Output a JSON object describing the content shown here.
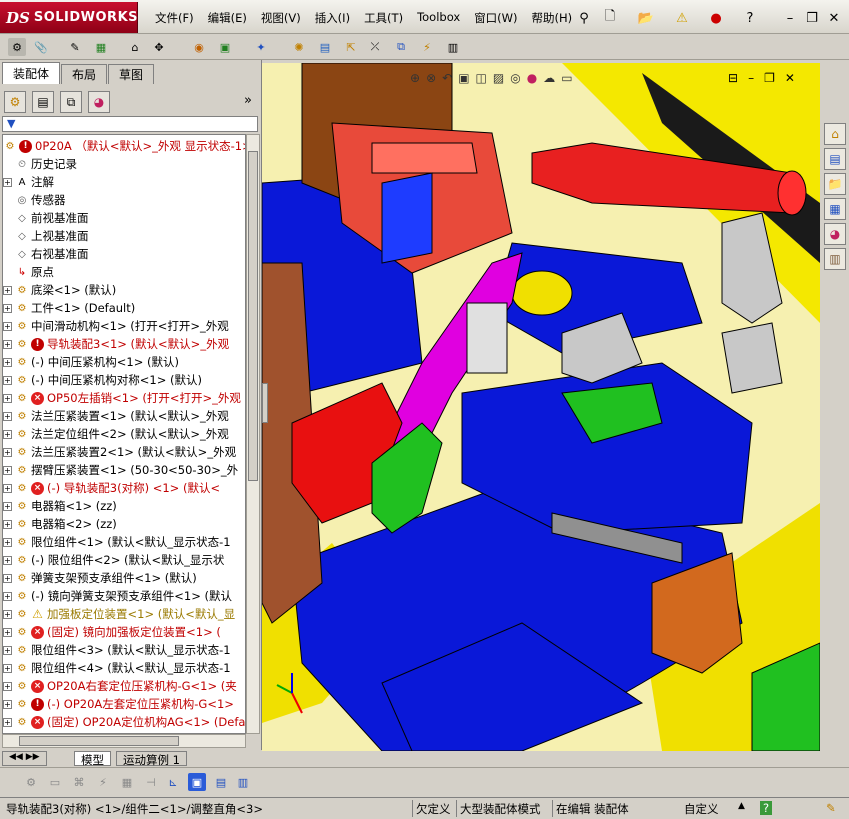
{
  "app": {
    "logo_ds": "DS",
    "logo_name": "SOLIDWORKS"
  },
  "menu": [
    "文件(F)",
    "编辑(E)",
    "视图(V)",
    "插入(I)",
    "工具(T)",
    "Toolbox",
    "窗口(W)",
    "帮助(H)"
  ],
  "panel_tabs": [
    "装配体",
    "布局",
    "草图"
  ],
  "tree": {
    "root": "0P20A （默认<默认>_外观 显示状态-1>）",
    "items": [
      {
        "label": "历史记录",
        "icon": "history-icon",
        "exp": false,
        "status": ""
      },
      {
        "label": "注解",
        "icon": "annotation-icon",
        "exp": true,
        "status": ""
      },
      {
        "label": "传感器",
        "icon": "sensor-icon",
        "exp": false,
        "status": ""
      },
      {
        "label": "前视基准面",
        "icon": "plane-icon",
        "exp": false,
        "status": ""
      },
      {
        "label": "上视基准面",
        "icon": "plane-icon",
        "exp": false,
        "status": ""
      },
      {
        "label": "右视基准面",
        "icon": "plane-icon",
        "exp": false,
        "status": ""
      },
      {
        "label": "原点",
        "icon": "origin-icon",
        "exp": false,
        "status": ""
      },
      {
        "label": "底梁<1> (默认)",
        "icon": "assembly-icon",
        "exp": true,
        "status": ""
      },
      {
        "label": "工件<1> (Default)",
        "icon": "assembly-icon",
        "exp": true,
        "status": ""
      },
      {
        "label": "中间滑动机构<1> (打开<打开>_外观",
        "icon": "assembly-icon",
        "exp": true,
        "status": ""
      },
      {
        "label": "导轨装配3<1> (默认<默认>_外观",
        "icon": "assembly-icon",
        "exp": true,
        "status": "error"
      },
      {
        "label": "(-) 中间压紧机构<1> (默认)",
        "icon": "assembly-icon",
        "exp": true,
        "status": ""
      },
      {
        "label": "(-) 中间压紧机构对称<1> (默认)",
        "icon": "assembly-icon",
        "exp": true,
        "status": ""
      },
      {
        "label": "OP50左插销<1> (打开<打开>_外观",
        "icon": "assembly-icon",
        "exp": true,
        "status": "stop"
      },
      {
        "label": "法兰压紧装置<1> (默认<默认>_外观",
        "icon": "assembly-icon",
        "exp": true,
        "status": ""
      },
      {
        "label": "法兰定位组件<2> (默认<默认>_外观",
        "icon": "assembly-icon",
        "exp": true,
        "status": ""
      },
      {
        "label": "法兰压紧装置2<1> (默认<默认>_外观",
        "icon": "assembly-icon",
        "exp": true,
        "status": ""
      },
      {
        "label": "摆臂压紧装置<1> (50-30<50-30>_外",
        "icon": "assembly-icon",
        "exp": true,
        "status": ""
      },
      {
        "label": "(-) 导轨装配3(对称) <1> (默认<",
        "icon": "assembly-icon",
        "exp": true,
        "status": "stop"
      },
      {
        "label": "电器箱<1> (zz)",
        "icon": "assembly-icon",
        "exp": true,
        "status": ""
      },
      {
        "label": "电器箱<2> (zz)",
        "icon": "assembly-icon",
        "exp": true,
        "status": ""
      },
      {
        "label": "限位组件<1> (默认<默认_显示状态-1",
        "icon": "assembly-icon",
        "exp": true,
        "status": ""
      },
      {
        "label": "(-) 限位组件<2> (默认<默认_显示状",
        "icon": "assembly-icon",
        "exp": true,
        "status": ""
      },
      {
        "label": "弹簧支架预支承组件<1> (默认)",
        "icon": "assembly-icon",
        "exp": true,
        "status": ""
      },
      {
        "label": "(-) 镜向弹簧支架预支承组件<1> (默认",
        "icon": "assembly-icon",
        "exp": true,
        "status": ""
      },
      {
        "label": "加强板定位装置<1> (默认<默认_显",
        "icon": "assembly-icon",
        "exp": true,
        "status": "warn"
      },
      {
        "label": "(固定) 镜向加强板定位装置<1> (",
        "icon": "assembly-icon",
        "exp": true,
        "status": "stop"
      },
      {
        "label": "限位组件<3> (默认<默认_显示状态-1",
        "icon": "assembly-icon",
        "exp": true,
        "status": ""
      },
      {
        "label": "限位组件<4> (默认<默认_显示状态-1",
        "icon": "assembly-icon",
        "exp": true,
        "status": ""
      },
      {
        "label": "OP20A右套定位压紧机构-G<1> (夹",
        "icon": "assembly-icon",
        "exp": true,
        "status": "stop"
      },
      {
        "label": "(-) OP20A左套定位压紧机构-G<1>",
        "icon": "assembly-icon",
        "exp": true,
        "status": "error"
      },
      {
        "label": "(固定) OP20A定位机构AG<1> (Defa",
        "icon": "assembly-icon",
        "exp": true,
        "status": "stop"
      }
    ]
  },
  "bottom_tabs": [
    "模型",
    "运动算例 1"
  ],
  "status": {
    "left": "导轨装配3(对称) <1>/组件二<1>/调整直角<3>",
    "undefined": "欠定义",
    "large_mode": "大型装配体模式",
    "editing": "在编辑 装配体",
    "custom": "自定义"
  },
  "colors": {
    "blue_plate": "#0a18d8",
    "yellow_base": "#f0e000",
    "magenta_part": "#e000e0",
    "red_part": "#e81010",
    "green_part": "#20c020"
  }
}
